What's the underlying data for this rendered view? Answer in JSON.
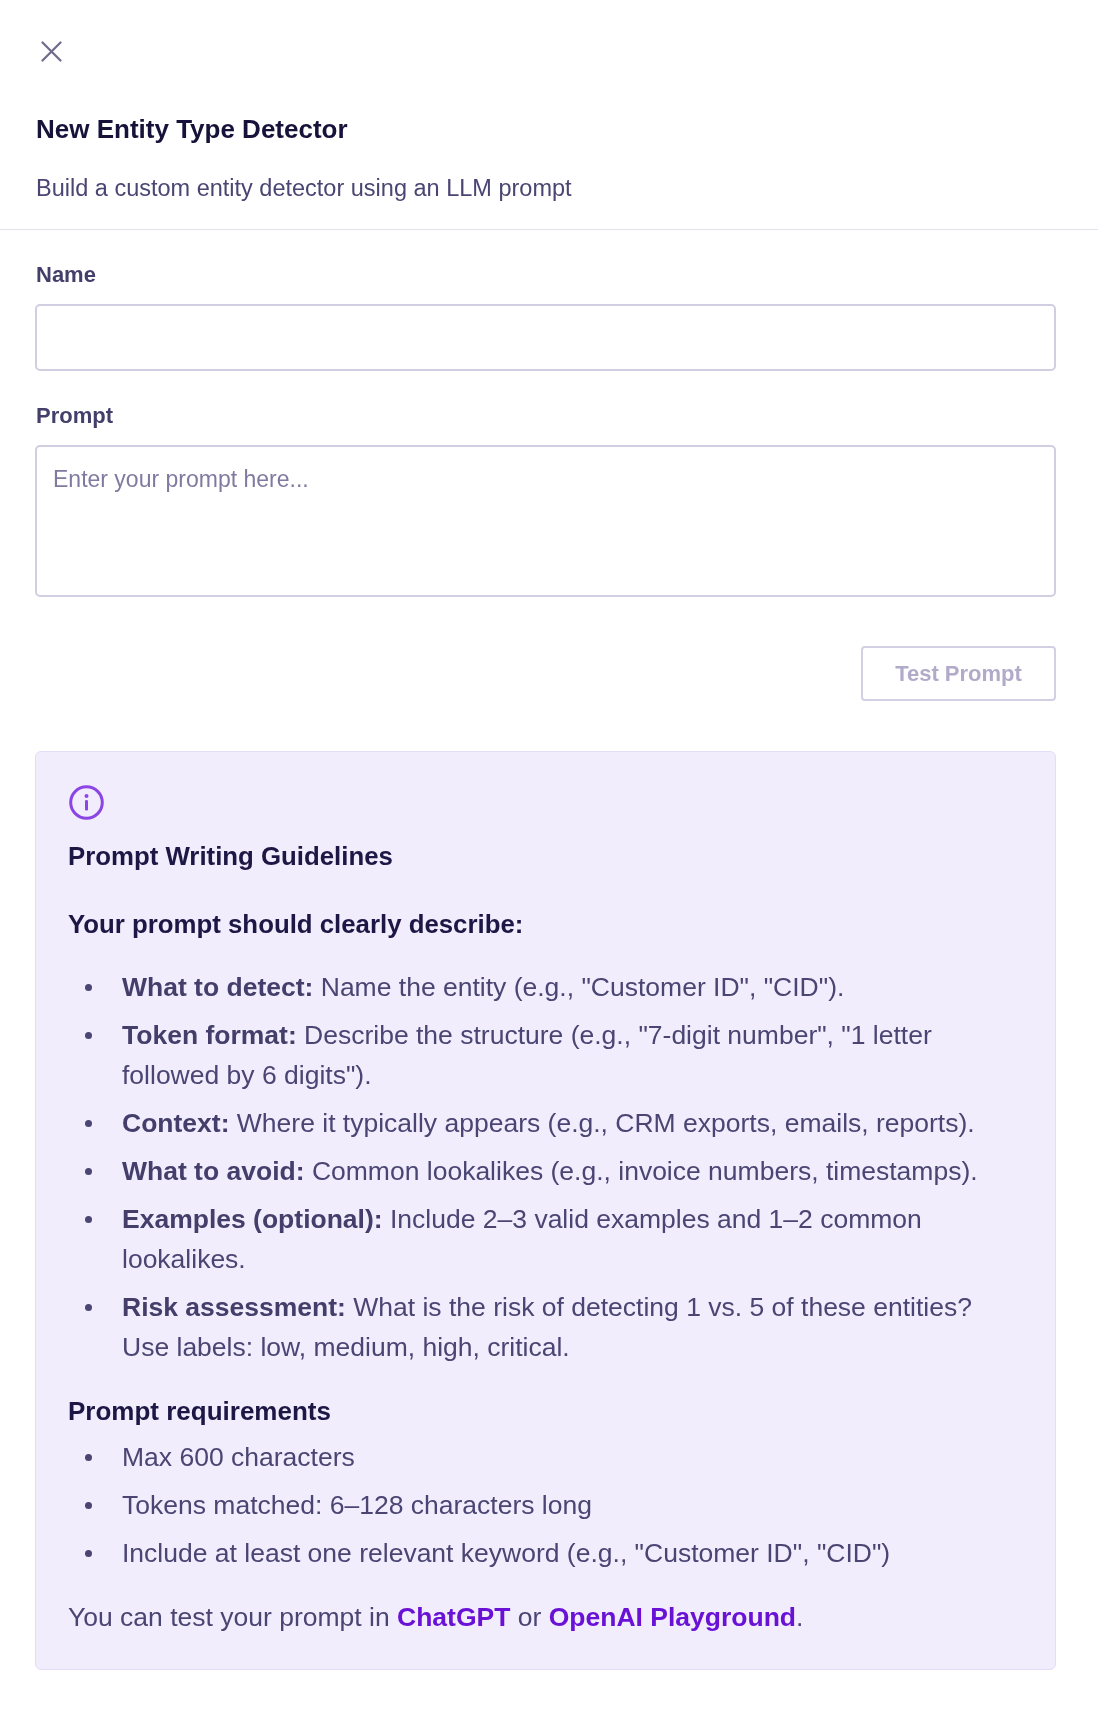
{
  "header": {
    "title": "New Entity Type Detector",
    "subtitle": "Build a custom entity detector using an LLM prompt"
  },
  "form": {
    "fields": [
      {
        "kind": "input",
        "label": "Name"
      },
      {
        "kind": "textarea",
        "label": "Prompt",
        "placeholder": "Enter your prompt here..."
      }
    ],
    "test_button": {
      "label": "Test Prompt",
      "disabled": true
    }
  },
  "guidelines": {
    "title": "Prompt Writing Guidelines",
    "intro": "Your prompt should clearly describe:",
    "items": [
      "**What to detect:** Name the entity (e.g., \"Customer ID\", \"CID\").",
      "**Token format:** Describe the structure (e.g., \"7-digit number\", \"1 letter followed by 6 digits\").",
      "**Context:** Where it typically appears (e.g., CRM exports, emails, reports).",
      "**What to avoid:** Common lookalikes (e.g., invoice numbers, timestamps).",
      "**Examples (optional):** Include 2–3 valid examples and 1–2 common lookalikes.",
      "**Risk assessment:** What is the risk of detecting 1 vs. 5 of these entities? Use labels: low, medium, high, critical."
    ],
    "requirements_title": "Prompt requirements",
    "requirements": [
      "Max 600 characters",
      "Tokens matched: 6–128 characters long",
      "Include at least one relevant keyword (e.g., \"Customer ID\", \"CID\")"
    ],
    "footer": [
      {
        "kind": "text",
        "text": "You can test your prompt in "
      },
      {
        "kind": "link",
        "text": "ChatGPT"
      },
      {
        "kind": "text",
        "text": " or "
      },
      {
        "kind": "link",
        "text": "OpenAI Playground"
      },
      {
        "kind": "text",
        "text": "."
      }
    ]
  }
}
